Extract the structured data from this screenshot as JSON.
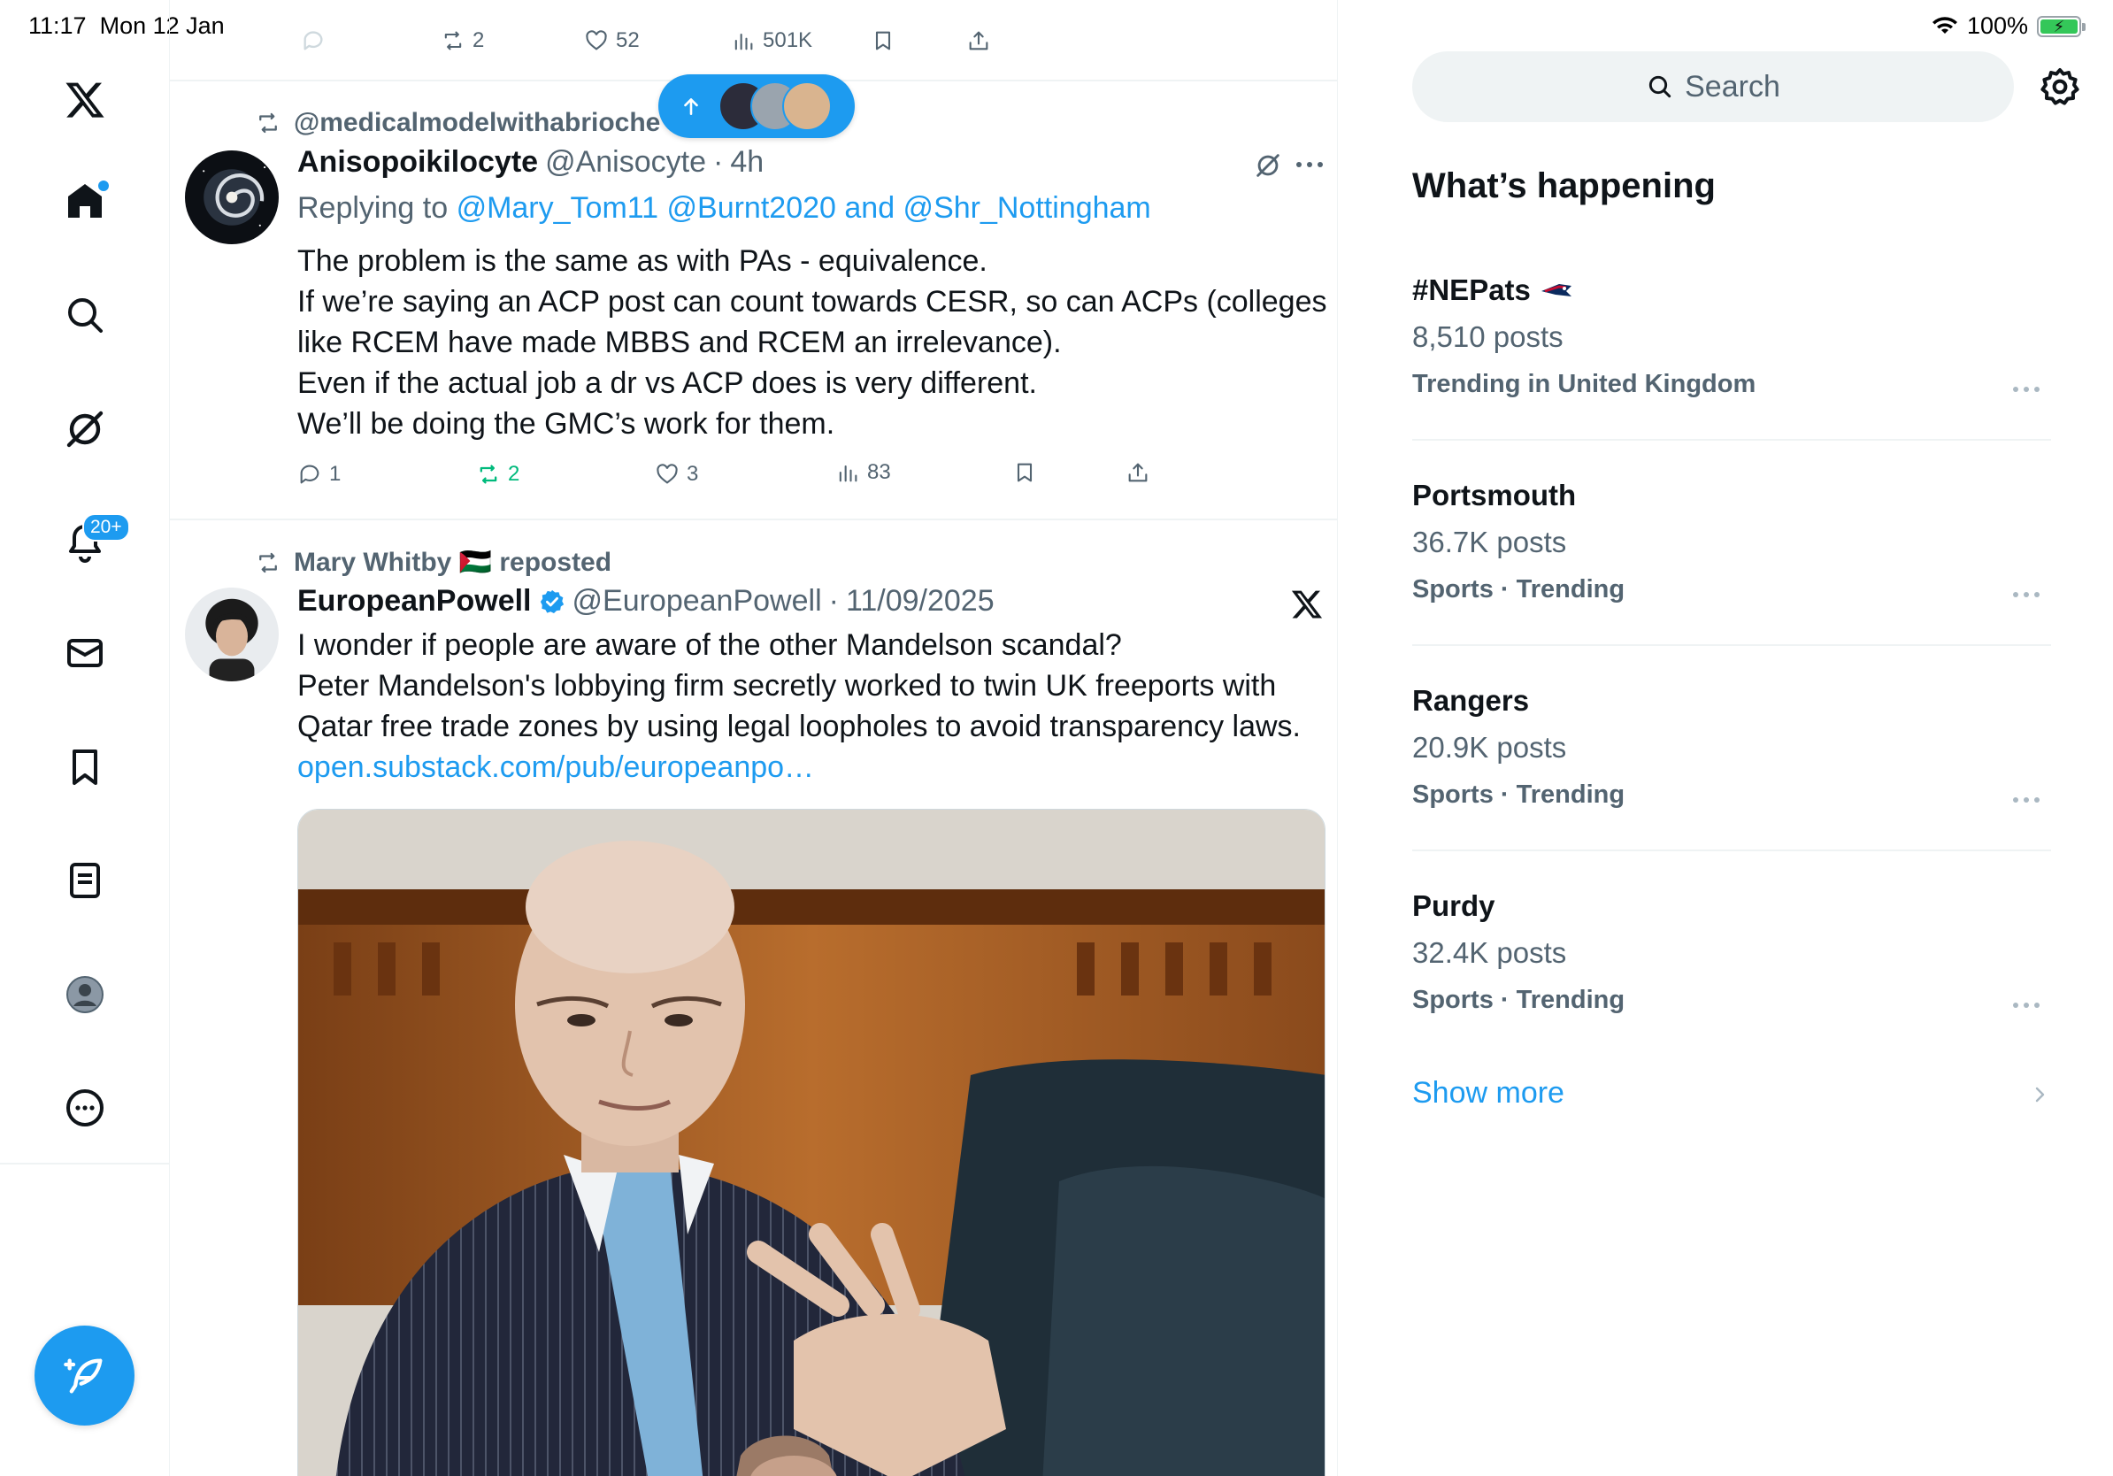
{
  "status_bar": {
    "time": "11:17",
    "date": "Mon 12 Jan",
    "battery": "100%"
  },
  "nav": {
    "notifications_badge": "20+"
  },
  "colors": {
    "accent": "#1d9bf0",
    "retweet_green": "#00ba7c",
    "secondary_text": "#536471"
  },
  "prev_tweet": {
    "retweets": "2",
    "likes": "52",
    "views": "501K"
  },
  "tweet1": {
    "repost_by": "@medicalmodelwithabrioche",
    "name": "Anisopoikilocyte",
    "handle": "@Anisocyte",
    "sep": "·",
    "time": "4h",
    "reply_prefix": "Replying to",
    "reply_mentions": "@Mary_Tom11 @Burnt2020 and @Shr_Nottingham",
    "lines": [
      "The problem is the same as with PAs - equivalence.",
      "If we’re saying an ACP post can count towards CESR, so can ACPs (colleges",
      "like RCEM have made MBBS and RCEM an irrelevance).",
      "Even if the actual job a dr vs ACP does is very different.",
      "We’ll be doing the GMC’s work for them."
    ],
    "replies": "1",
    "retweets": "2",
    "likes": "3",
    "views": "83"
  },
  "tweet2": {
    "repost_by": "Mary Whitby 🇵🇸 reposted",
    "name": "EuropeanPowell",
    "handle": "@EuropeanPowell",
    "sep": "·",
    "date": "11/09/2025",
    "lines": [
      "I wonder if people are aware of the other Mandelson scandal?",
      "Peter Mandelson's lobbying firm secretly worked to twin UK freeports with",
      "Qatar free trade zones by using legal loopholes to avoid transparency laws."
    ],
    "link": "open.substack.com/pub/europeanpo…"
  },
  "sidebar": {
    "search_placeholder": "Search",
    "title": "What’s happening",
    "trends": [
      {
        "name": "#NEPats",
        "posts": "8,510 posts",
        "meta": "Trending in United Kingdom"
      },
      {
        "name": "Portsmouth",
        "posts": "36.7K posts",
        "meta": "Sports · Trending"
      },
      {
        "name": "Rangers",
        "posts": "20.9K posts",
        "meta": "Sports · Trending"
      },
      {
        "name": "Purdy",
        "posts": "32.4K posts",
        "meta": "Sports · Trending"
      }
    ],
    "show_more": "Show more"
  }
}
